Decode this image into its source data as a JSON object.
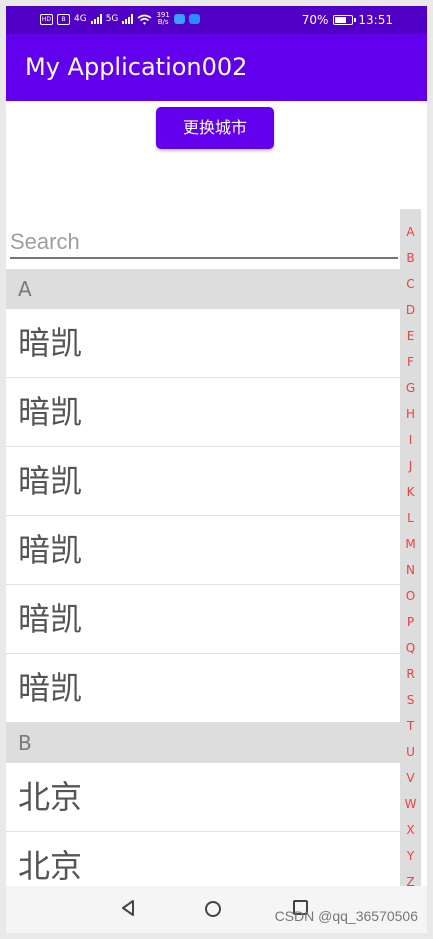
{
  "status_bar": {
    "left_badges": [
      "HD",
      "B"
    ],
    "signal_labels": [
      "4G",
      "5G"
    ],
    "network_speed": "391\nB/s",
    "battery": "70%",
    "battery_level": 0.7,
    "time": "13:51",
    "icons": [
      "wifi-icon",
      "battery-icon",
      "app-status-icon"
    ]
  },
  "app_bar": {
    "title": "My Application002"
  },
  "actions": {
    "change_city_label": "更换城市"
  },
  "search": {
    "placeholder": "Search"
  },
  "groups": [
    {
      "header": "A",
      "items": [
        "暗凯",
        "暗凯",
        "暗凯",
        "暗凯",
        "暗凯",
        "暗凯"
      ]
    },
    {
      "header": "B",
      "items": [
        "北京",
        "北京"
      ]
    }
  ],
  "index_letters": [
    "A",
    "B",
    "C",
    "D",
    "E",
    "F",
    "G",
    "H",
    "I",
    "J",
    "K",
    "L",
    "M",
    "N",
    "O",
    "P",
    "Q",
    "R",
    "S",
    "T",
    "U",
    "V",
    "W",
    "X",
    "Y",
    "Z"
  ],
  "navigation": {
    "icons": [
      "back-icon",
      "home-icon",
      "recent-apps-icon"
    ]
  },
  "watermark": "CSDN @qq_36570506",
  "colors": {
    "status_bar": "#4f00c4",
    "primary": "#6200ee",
    "index_text": "#f04040",
    "section_background": "#dddddd"
  }
}
